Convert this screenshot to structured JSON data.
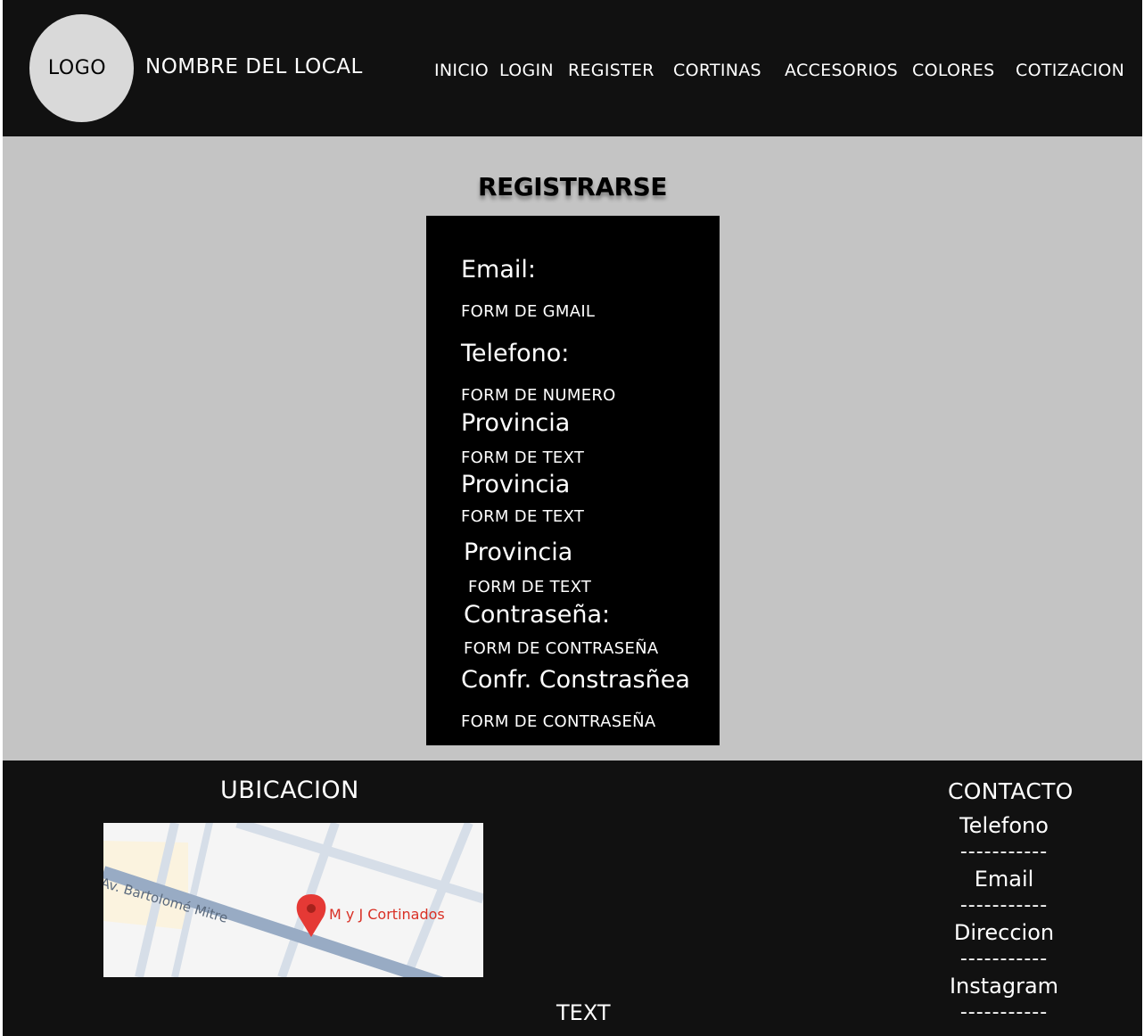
{
  "header": {
    "logo_text": "LOGO",
    "local_name": "NOMBRE DEL LOCAL",
    "nav": [
      "INICIO",
      "LOGIN",
      "REGISTER",
      "CORTINAS",
      "ACCESORIOS",
      "COLORES",
      "COTIZACION"
    ]
  },
  "main": {
    "title": "REGISTRARSE",
    "form": {
      "email_label": "Email:",
      "email_field": "FORM DE GMAIL",
      "phone_label": "Telefono:",
      "phone_field": "FORM DE NUMERO",
      "province1_label": "Provincia",
      "province1_field": "FORM DE TEXT",
      "province2_label": "Provincia",
      "province2_field": "FORM DE TEXT",
      "province3_label": "Provincia",
      "province3_field": "FORM DE TEXT",
      "password_label": "Contraseña:",
      "password_field": "FORM DE CONTRASEÑA",
      "confirm_label": "Confr. Constrasñea",
      "confirm_field": "FORM DE CONTRASEÑA"
    }
  },
  "footer": {
    "location_title": "UBICACION",
    "map": {
      "street": "Av. Bartolomé Mitre",
      "place": "M y J Cortinados"
    },
    "text": "TEXT",
    "contact": {
      "title": "CONTACTO",
      "items": [
        "Telefono",
        "Email",
        "Direccion",
        "Instagram"
      ],
      "separator": "-----------"
    }
  },
  "colors": {
    "header_bg": "#111111",
    "main_bg": "#c4c4c4",
    "form_bg": "#000000",
    "logo_bg": "#d9d9d9",
    "map_pin": "#e53935"
  }
}
